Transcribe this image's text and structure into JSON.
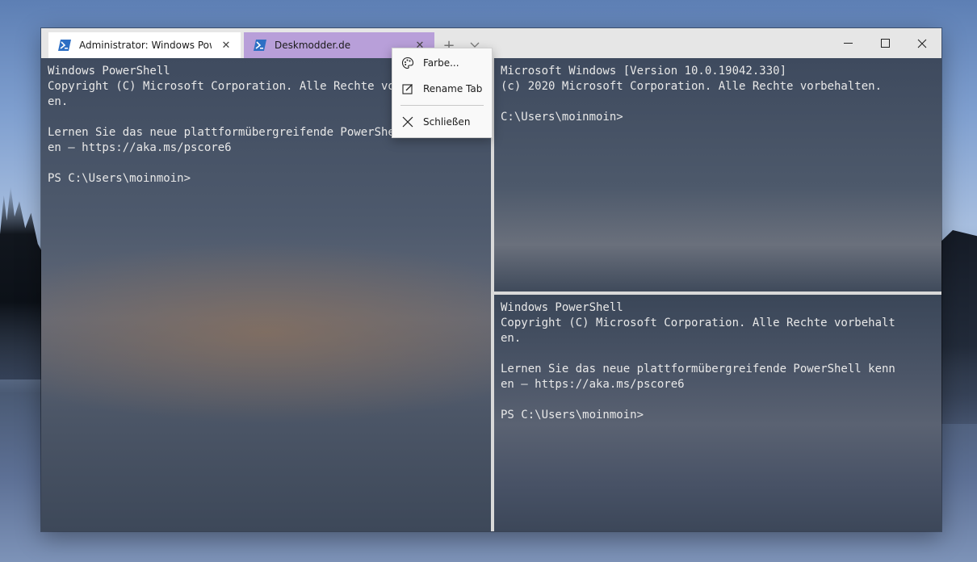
{
  "tabs": [
    {
      "title": "Administrator: Windows PowerShell",
      "active": true,
      "icon": "powershell-icon"
    },
    {
      "title": "Deskmodder.de",
      "active": false,
      "icon": "powershell-icon",
      "color": "#b89fd9"
    }
  ],
  "tabbar": {
    "new_tab": "+",
    "dropdown": "⌵"
  },
  "window_controls": {
    "minimize": "–",
    "maximize": "☐",
    "close": "✕"
  },
  "panes": {
    "left": "Windows PowerShell\nCopyright (C) Microsoft Corporation. Alle Rechte vorbehalt\nen.\n\nLernen Sie das neue plattformübergreifende PowerShell kenn\nen – https://aka.ms/pscore6\n\nPS C:\\Users\\moinmoin>",
    "right_top": "Microsoft Windows [Version 10.0.19042.330]\n(c) 2020 Microsoft Corporation. Alle Rechte vorbehalten.\n\nC:\\Users\\moinmoin>",
    "right_bottom": "Windows PowerShell\nCopyright (C) Microsoft Corporation. Alle Rechte vorbehalt\nen.\n\nLernen Sie das neue plattformübergreifende PowerShell kenn\nen – https://aka.ms/pscore6\n\nPS C:\\Users\\moinmoin>"
  },
  "context_menu": {
    "items": [
      {
        "label": "Farbe...",
        "icon": "palette-icon"
      },
      {
        "label": "Rename Tab",
        "icon": "rename-icon"
      },
      {
        "label": "Schließen",
        "icon": "close-icon"
      }
    ]
  },
  "colors": {
    "tab_accent": "#b89fd9",
    "titlebar": "#e6e6e6",
    "divider": "#d9d9d9"
  }
}
